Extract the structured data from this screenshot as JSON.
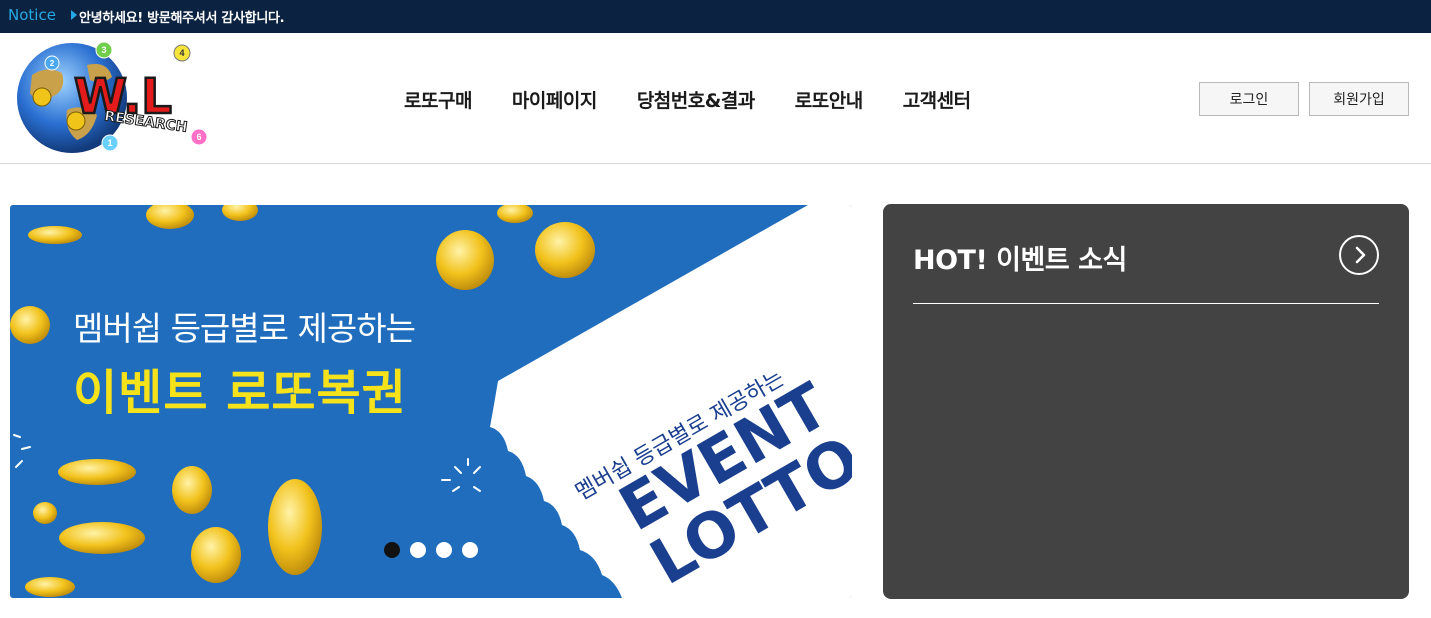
{
  "notice": {
    "label": "Notice",
    "message": "안녕하세요! 방문해주셔서 감사합니다."
  },
  "logo": {
    "text_main": "W.L",
    "text_sub": "RESEARCH",
    "ball_numbers": [
      "2",
      "3",
      "4",
      "6",
      "1"
    ]
  },
  "nav": {
    "items": [
      {
        "label": "로또구매"
      },
      {
        "label": "마이페이지"
      },
      {
        "label": "당첨번호&결과"
      },
      {
        "label": "로또안내"
      },
      {
        "label": "고객센터"
      }
    ]
  },
  "auth": {
    "login_label": "로그인",
    "signup_label": "회원가입"
  },
  "banner": {
    "subtitle": "멤버쉽 등급별로 제공하는",
    "title": "이벤트 로또복권",
    "ticket_subtitle": "멤버쉽 등급별로 제공하는",
    "ticket_line1": "EVENT",
    "ticket_line2": "LOTTO",
    "slide_count": 4,
    "active_slide": 1
  },
  "event_panel": {
    "title": "HOT! 이벤트 소식",
    "more_icon": "chevron-right-icon"
  },
  "colors": {
    "notice_bg": "#0b2340",
    "notice_label": "#27a8e6",
    "banner_bg": "#1f6dbc",
    "banner_title": "#f6e21a",
    "ticket_text": "#1b3f8f",
    "panel_bg": "#434343"
  }
}
